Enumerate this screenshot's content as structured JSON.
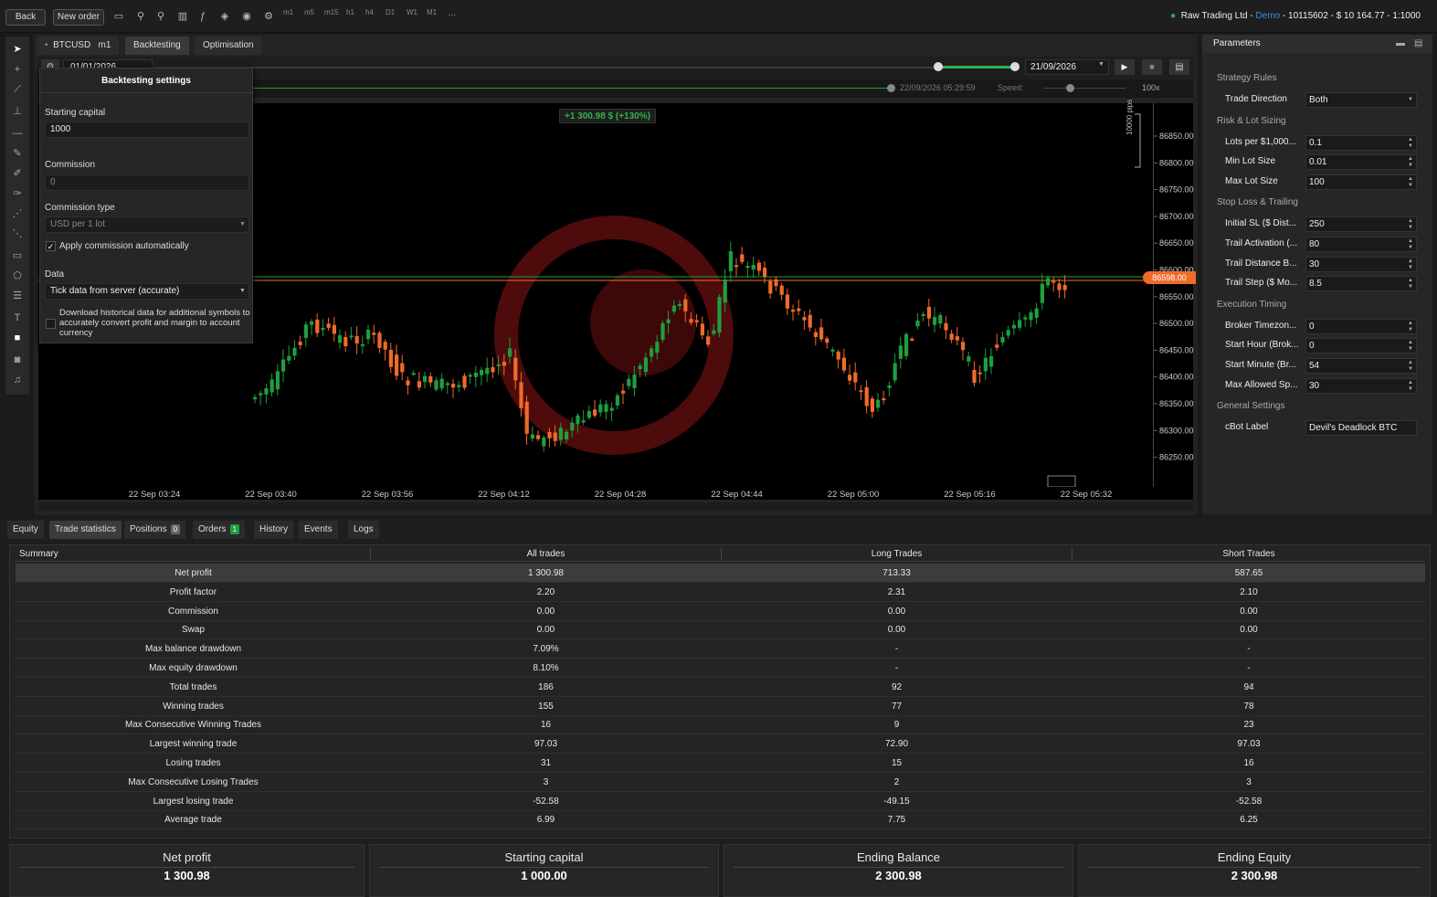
{
  "toolbar": {
    "back_label": "Back",
    "new_order_label": "New order",
    "timeframes": [
      "m1",
      "m5",
      "m15",
      "h1",
      "h4",
      "D1",
      "W1",
      "M1"
    ],
    "more": "..."
  },
  "account": {
    "broker": "Raw Trading Ltd",
    "sep1": " - ",
    "mode": "Demo",
    "rest": " - 10115602 - $ 10 164.77 - 1:1000",
    "status_color": "#2fb34a"
  },
  "chart_tabs": {
    "symbol": "BTCUSD",
    "timeframe": "m1",
    "backtesting": "Backtesting",
    "optimisation": "Optimisation"
  },
  "range": {
    "start_date": "01/01/2026",
    "end_date": "21/09/2026",
    "current_time": "22/09/2026 05:29:59",
    "speed_label": "Speed:",
    "speed_value": "100x"
  },
  "chart": {
    "pnl_label": "+1 300.98 $ (+130%)",
    "pips_label": "10000 pips",
    "current_price": "86598.00",
    "price_ticks": [
      "86850.00",
      "86800.00",
      "86750.00",
      "86700.00",
      "86650.00",
      "86600.00",
      "86550.00",
      "86500.00",
      "86450.00",
      "86400.00",
      "86350.00",
      "86300.00",
      "86250.00"
    ],
    "time_ticks": [
      "22 Sep 03:24",
      "22 Sep 03:40",
      "22 Sep 03:56",
      "22 Sep 04:12",
      "22 Sep 04:28",
      "22 Sep 04:44",
      "22 Sep 05:00",
      "22 Sep 05:16",
      "22 Sep 05:32"
    ],
    "up_color": "#1f9e3d",
    "down_color": "#f06a2a"
  },
  "backtest_settings": {
    "title": "Backtesting settings",
    "starting_capital_label": "Starting capital",
    "starting_capital_value": "1000",
    "commission_label": "Commission",
    "commission_value": "0",
    "commission_type_label": "Commission type",
    "commission_type_value": "USD per 1 lot",
    "apply_commission_label": "Apply commission automatically",
    "data_label": "Data",
    "data_value": "Tick data from server (accurate)",
    "download_label": "Download historical data for additional symbols to accurately convert profit and margin to account currency"
  },
  "parameters": {
    "title": "Parameters",
    "groups": [
      {
        "heading": "Strategy Rules",
        "items": [
          {
            "label": "Trade Direction",
            "value": "Both",
            "type": "select"
          }
        ]
      },
      {
        "heading": "Risk & Lot Sizing",
        "items": [
          {
            "label": "Lots per $1,000...",
            "value": "0.1",
            "type": "num"
          },
          {
            "label": "Min Lot Size",
            "value": "0.01",
            "type": "num"
          },
          {
            "label": "Max Lot Size",
            "value": "100",
            "type": "num"
          }
        ]
      },
      {
        "heading": "Stop Loss & Trailing",
        "items": [
          {
            "label": "Initial SL ($ Dist...",
            "value": "250",
            "type": "num"
          },
          {
            "label": "Trail Activation (...",
            "value": "80",
            "type": "num"
          },
          {
            "label": "Trail Distance B...",
            "value": "30",
            "type": "num"
          },
          {
            "label": "Trail Step ($ Mo...",
            "value": "8.5",
            "type": "num"
          }
        ]
      },
      {
        "heading": "Execution Timing",
        "items": [
          {
            "label": "Broker Timezon...",
            "value": "0",
            "type": "num"
          },
          {
            "label": "Start Hour (Brok...",
            "value": "0",
            "type": "num"
          },
          {
            "label": "Start Minute (Br...",
            "value": "54",
            "type": "num"
          },
          {
            "label": "Max Allowed Sp...",
            "value": "30",
            "type": "num"
          }
        ]
      },
      {
        "heading": "General Settings",
        "items": [
          {
            "label": "cBot Label",
            "value": "Devil's Deadlock BTC",
            "type": "text"
          }
        ]
      }
    ]
  },
  "bottom_tabs": {
    "equity": "Equity",
    "trade_statistics": "Trade statistics",
    "positions": "Positions",
    "positions_count": "0",
    "orders": "Orders",
    "orders_count": "1",
    "history": "History",
    "events": "Events",
    "logs": "Logs"
  },
  "stats": {
    "headers": [
      "Summary",
      "All trades",
      "Long Trades",
      "Short Trades"
    ],
    "rows": [
      [
        "Net profit",
        "1 300.98",
        "713.33",
        "587.65"
      ],
      [
        "Profit factor",
        "2.20",
        "2.31",
        "2.10"
      ],
      [
        "Commission",
        "0.00",
        "0.00",
        "0.00"
      ],
      [
        "Swap",
        "0.00",
        "0.00",
        "0.00"
      ],
      [
        "Max balance drawdown",
        "7.09%",
        "-",
        "-"
      ],
      [
        "Max equity drawdown",
        "8.10%",
        "-",
        "-"
      ],
      [
        "Total trades",
        "186",
        "92",
        "94"
      ],
      [
        "Winning trades",
        "155",
        "77",
        "78"
      ],
      [
        "Max Consecutive Winning Trades",
        "16",
        "9",
        "23"
      ],
      [
        "Largest winning trade",
        "97.03",
        "72.90",
        "97.03"
      ],
      [
        "Losing trades",
        "31",
        "15",
        "16"
      ],
      [
        "Max Consecutive Losing Trades",
        "3",
        "2",
        "3"
      ],
      [
        "Largest losing trade",
        "-52.58",
        "-49.15",
        "-52.58"
      ],
      [
        "Average trade",
        "6.99",
        "7.75",
        "6.25"
      ]
    ]
  },
  "summary_cards": [
    {
      "title": "Net profit",
      "value": "1 300.98"
    },
    {
      "title": "Starting capital",
      "value": "1 000.00"
    },
    {
      "title": "Ending Balance",
      "value": "2 300.98"
    },
    {
      "title": "Ending Equity",
      "value": "2 300.98"
    }
  ]
}
